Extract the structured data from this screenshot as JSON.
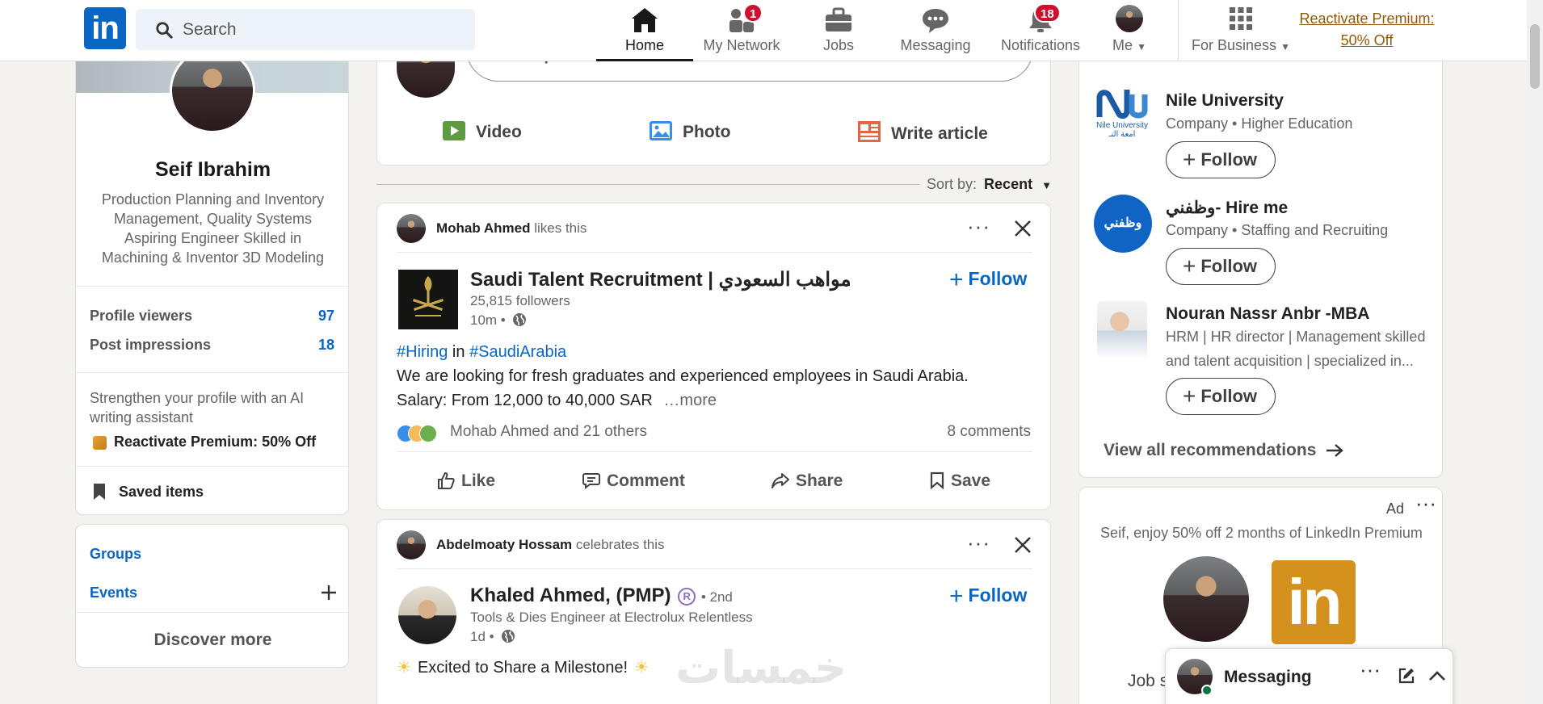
{
  "nav": {
    "search_placeholder": "Search",
    "items": [
      {
        "label": "Home"
      },
      {
        "label": "My Network",
        "badge": "1"
      },
      {
        "label": "Jobs"
      },
      {
        "label": "Messaging"
      },
      {
        "label": "Notifications",
        "badge": "18"
      },
      {
        "label": "Me"
      },
      {
        "label": "For Business"
      }
    ],
    "premium_line1": "Reactivate Premium:",
    "premium_line2": "50% Off"
  },
  "profile": {
    "name": "Seif Ibrahim",
    "headline_lines": [
      "Production Planning and Inventory",
      "Management, Quality Systems",
      "Aspiring Engineer Skilled in",
      "Machining & Inventor 3D Modeling"
    ],
    "viewers_label": "Profile viewers",
    "viewers_value": "97",
    "impressions_label": "Post impressions",
    "impressions_value": "18",
    "promo_line1": "Strengthen your profile with an AI",
    "promo_line2": "writing assistant",
    "promo_link": "Reactivate Premium: 50% Off",
    "saved_items": "Saved items"
  },
  "left_links": {
    "groups": "Groups",
    "events": "Events",
    "discover": "Discover more"
  },
  "composer": {
    "placeholder": "Start a post",
    "video": "Video",
    "photo": "Photo",
    "article": "Write article"
  },
  "sort": {
    "label": "Sort by:",
    "value": "Recent"
  },
  "post1": {
    "actor": "Mohab Ahmed",
    "action": "likes this",
    "company": "Saudi Talent Recruitment | توظيف المواهب السعودي ...",
    "followers": "25,815 followers",
    "time": "10m •",
    "follow": "Follow",
    "tag1": "#Hiring",
    "in": "in",
    "tag2": "#SaudiArabia",
    "line1": "We are looking for fresh graduates and experienced employees in Saudi Arabia.",
    "line2": "Salary: From 12,000 to 40,000 SAR",
    "more": "…more",
    "reactions": "Mohab Ahmed and 21 others",
    "comments": "8 comments",
    "like": "Like",
    "comment": "Comment",
    "share": "Share",
    "save": "Save"
  },
  "post2": {
    "actor": "Abdelmoaty Hossam",
    "action": "celebrates this",
    "author": "Khaled Ahmed, (PMP)",
    "degree": "• 2nd",
    "headline": "Tools & Dies Engineer at Electrolux Relentless",
    "time": "1d •",
    "follow": "Follow",
    "text": "Excited to Share a Milestone!"
  },
  "recommendations": {
    "items": [
      {
        "name": "Nile University",
        "desc": "Company • Higher Education",
        "follow": "Follow"
      },
      {
        "name": "وظفني- Hire me",
        "desc": "Company • Staffing and Recruiting",
        "follow": "Follow"
      },
      {
        "name": "Nouran Nassr Anbr -MBA",
        "desc_line1": "HRM | HR director | Management skilled",
        "desc_line2": "and talent acquisition | specialized in...",
        "follow": "Follow"
      }
    ],
    "logo_nile_top": "Nile University",
    "logo_nile_bottom": "امعة النـ",
    "logo_hire": "وظفني",
    "view_all": "View all recommendations"
  },
  "ad": {
    "label": "Ad",
    "text": "Seif, enjoy 50% off 2 months of LinkedIn Premium",
    "logo": "in",
    "bottom_partial": "Job s"
  },
  "messaging": {
    "title": "Messaging"
  },
  "watermark": "خمسات",
  "colors": {
    "brand": "#0a66c2",
    "badge": "#cb112d",
    "premium": "#915907",
    "background": "#f4f2ee"
  }
}
